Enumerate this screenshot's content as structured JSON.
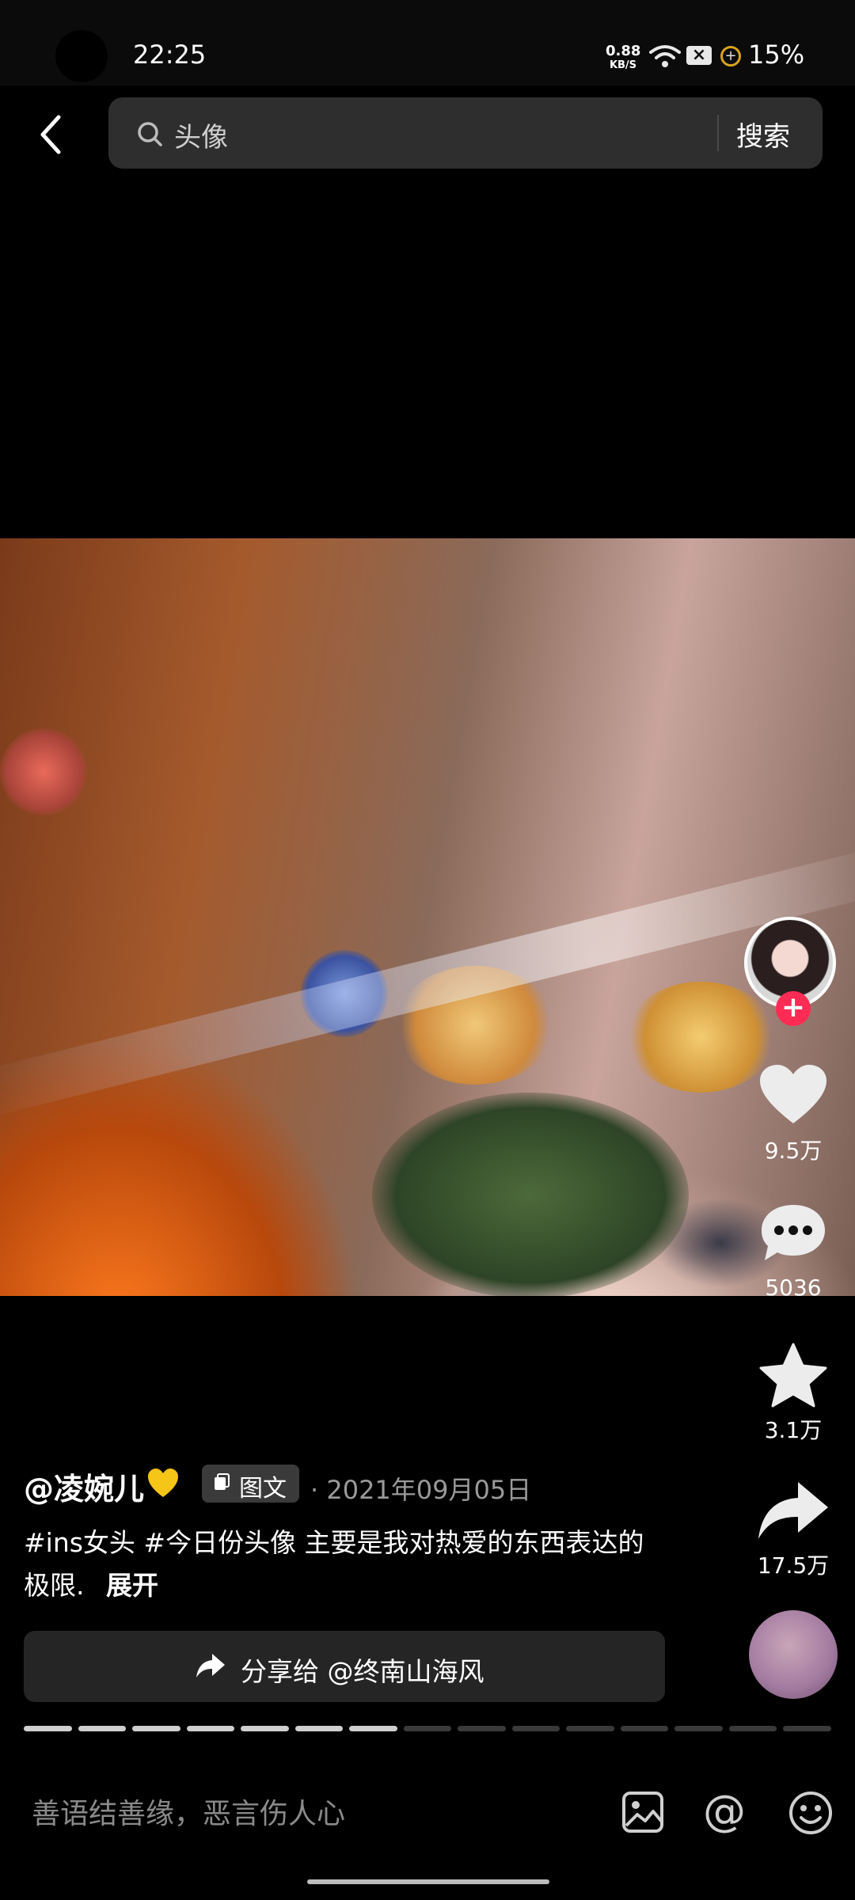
{
  "status_bar": {
    "time": "22:25",
    "net_speed": "0.88",
    "net_speed_unit": "KB/S",
    "battery_pct": "15%",
    "icons": [
      "wifi-icon",
      "sim-x-icon",
      "battery-saver-icon"
    ]
  },
  "search": {
    "query": "头像",
    "button_label": "搜索"
  },
  "actions": {
    "likes": "9.5万",
    "comments": "5036",
    "favorites": "3.1万",
    "shares": "17.5万"
  },
  "post": {
    "author": "@凌婉儿",
    "author_emoji": "💛",
    "type_label": "图文",
    "date": "· 2021年09月05日",
    "caption_line1": "#ins女头 #今日份头像 主要是我对热爱的东西表达的",
    "caption_line2": "极限.",
    "expand_label": "展开",
    "share_label": "分享给 @终南山海风"
  },
  "carousel": {
    "total_pages": 15,
    "current_page": 7
  },
  "comment_bar": {
    "placeholder": "善语结善缘，恶言伤人心"
  },
  "colors": {
    "accent": "#fe2c55",
    "progress_active": "#cfcfcf",
    "progress_inactive": "#3a3a3a"
  }
}
